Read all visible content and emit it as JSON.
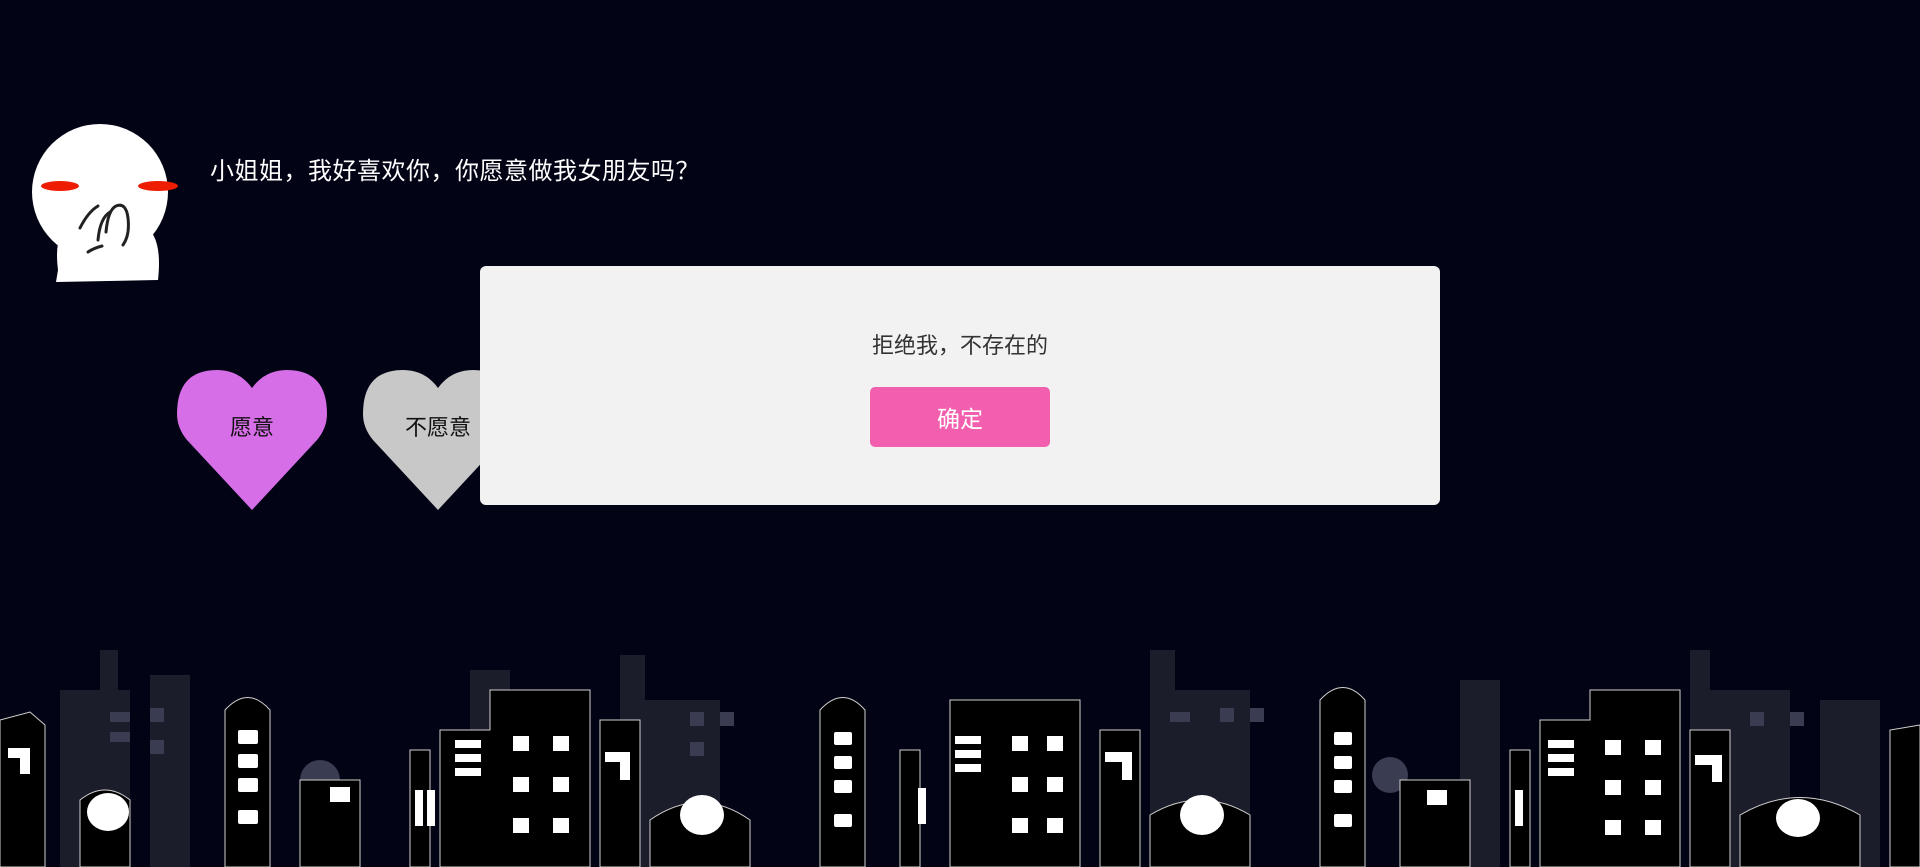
{
  "prompt": {
    "question": "小姐姐，我好喜欢你，你愿意做我女朋友吗？"
  },
  "choices": {
    "yes_label": "愿意",
    "no_label": "不愿意"
  },
  "dialog": {
    "message": "拒绝我，不存在的",
    "confirm_label": "确定"
  },
  "colors": {
    "background": "#020314",
    "yes_heart": "#d66ee8",
    "no_heart": "#c8c8c8",
    "dialog_bg": "#f2f2f2",
    "confirm_button": "#f25fae"
  },
  "icons": {
    "avatar": "blushing-character-icon",
    "skyline": "city-skyline-illustration"
  }
}
